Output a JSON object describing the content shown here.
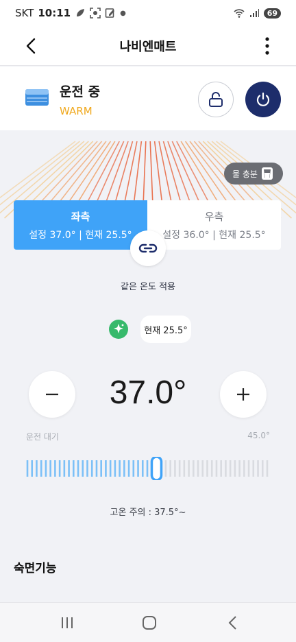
{
  "status_bar": {
    "carrier": "SKT",
    "time": "10:11",
    "battery": "69"
  },
  "header": {
    "title": "나비엔매트"
  },
  "device": {
    "status": "운전 중",
    "mode": "WARM"
  },
  "water": {
    "label": "물 충분"
  },
  "sides": {
    "left": {
      "name": "좌측",
      "info": "설정 37.0° | 현재 25.5°"
    },
    "right": {
      "name": "우측",
      "info": "설정 36.0° | 현재 25.5°"
    }
  },
  "link": {
    "label": "같은 온도 적용"
  },
  "current": {
    "label": "현재 25.5°"
  },
  "temperature": {
    "value": "37.0°",
    "min_label": "운전 대기",
    "max_label": "45.0°"
  },
  "slider": {
    "level": 0.54
  },
  "caution": {
    "label": "고온 주의 : 37.5°~"
  },
  "sleep": {
    "title": "숙면기능"
  },
  "colors": {
    "accent": "#3fa3f8",
    "power": "#1d2d6b",
    "mode": "#f0a81c",
    "ai": "#37b96b"
  },
  "icons": [
    "back-arrow-icon",
    "more-vertical-icon",
    "mattress-icon",
    "unlock-icon",
    "power-icon",
    "cup-icon",
    "link-icon",
    "sparkle-icon",
    "minus-icon",
    "plus-icon"
  ]
}
